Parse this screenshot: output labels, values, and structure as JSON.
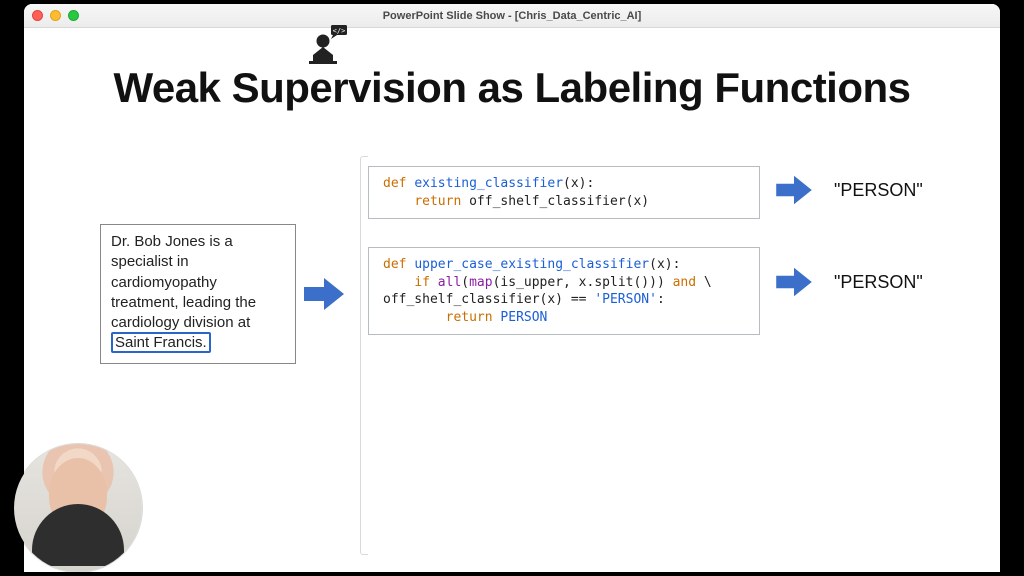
{
  "window": {
    "title": "PowerPoint Slide Show - [Chris_Data_Centric_AI]"
  },
  "slide": {
    "title": "Weak Supervision as Labeling Functions",
    "example": {
      "prefix": "Dr. Bob Jones is a specialist in cardiomyopathy treatment, leading the cardiology division at ",
      "highlight": "Saint Francis."
    },
    "code1": {
      "def": "def",
      "fname": "existing_classifier",
      "args": "(x):",
      "line2a": "    ",
      "ret": "return",
      "line2b": " off_shelf_classifier(x)"
    },
    "code2": {
      "def": "def",
      "fname": "upper_case_existing_classifier",
      "args": "(x):",
      "l2a": "    ",
      "if": "if",
      "l2b": " ",
      "all": "all",
      "l2c": "(",
      "map": "map",
      "l2d": "(is_upper, x.split())) ",
      "and": "and",
      "l2e": " \\",
      "l3a": "off_shelf_classifier(x) == ",
      "str": "'PERSON'",
      "l3b": ":",
      "l4a": "        ",
      "ret": "return",
      "l4b": " ",
      "const": "PERSON"
    },
    "output1": "\"PERSON\"",
    "output2": "\"PERSON\""
  }
}
